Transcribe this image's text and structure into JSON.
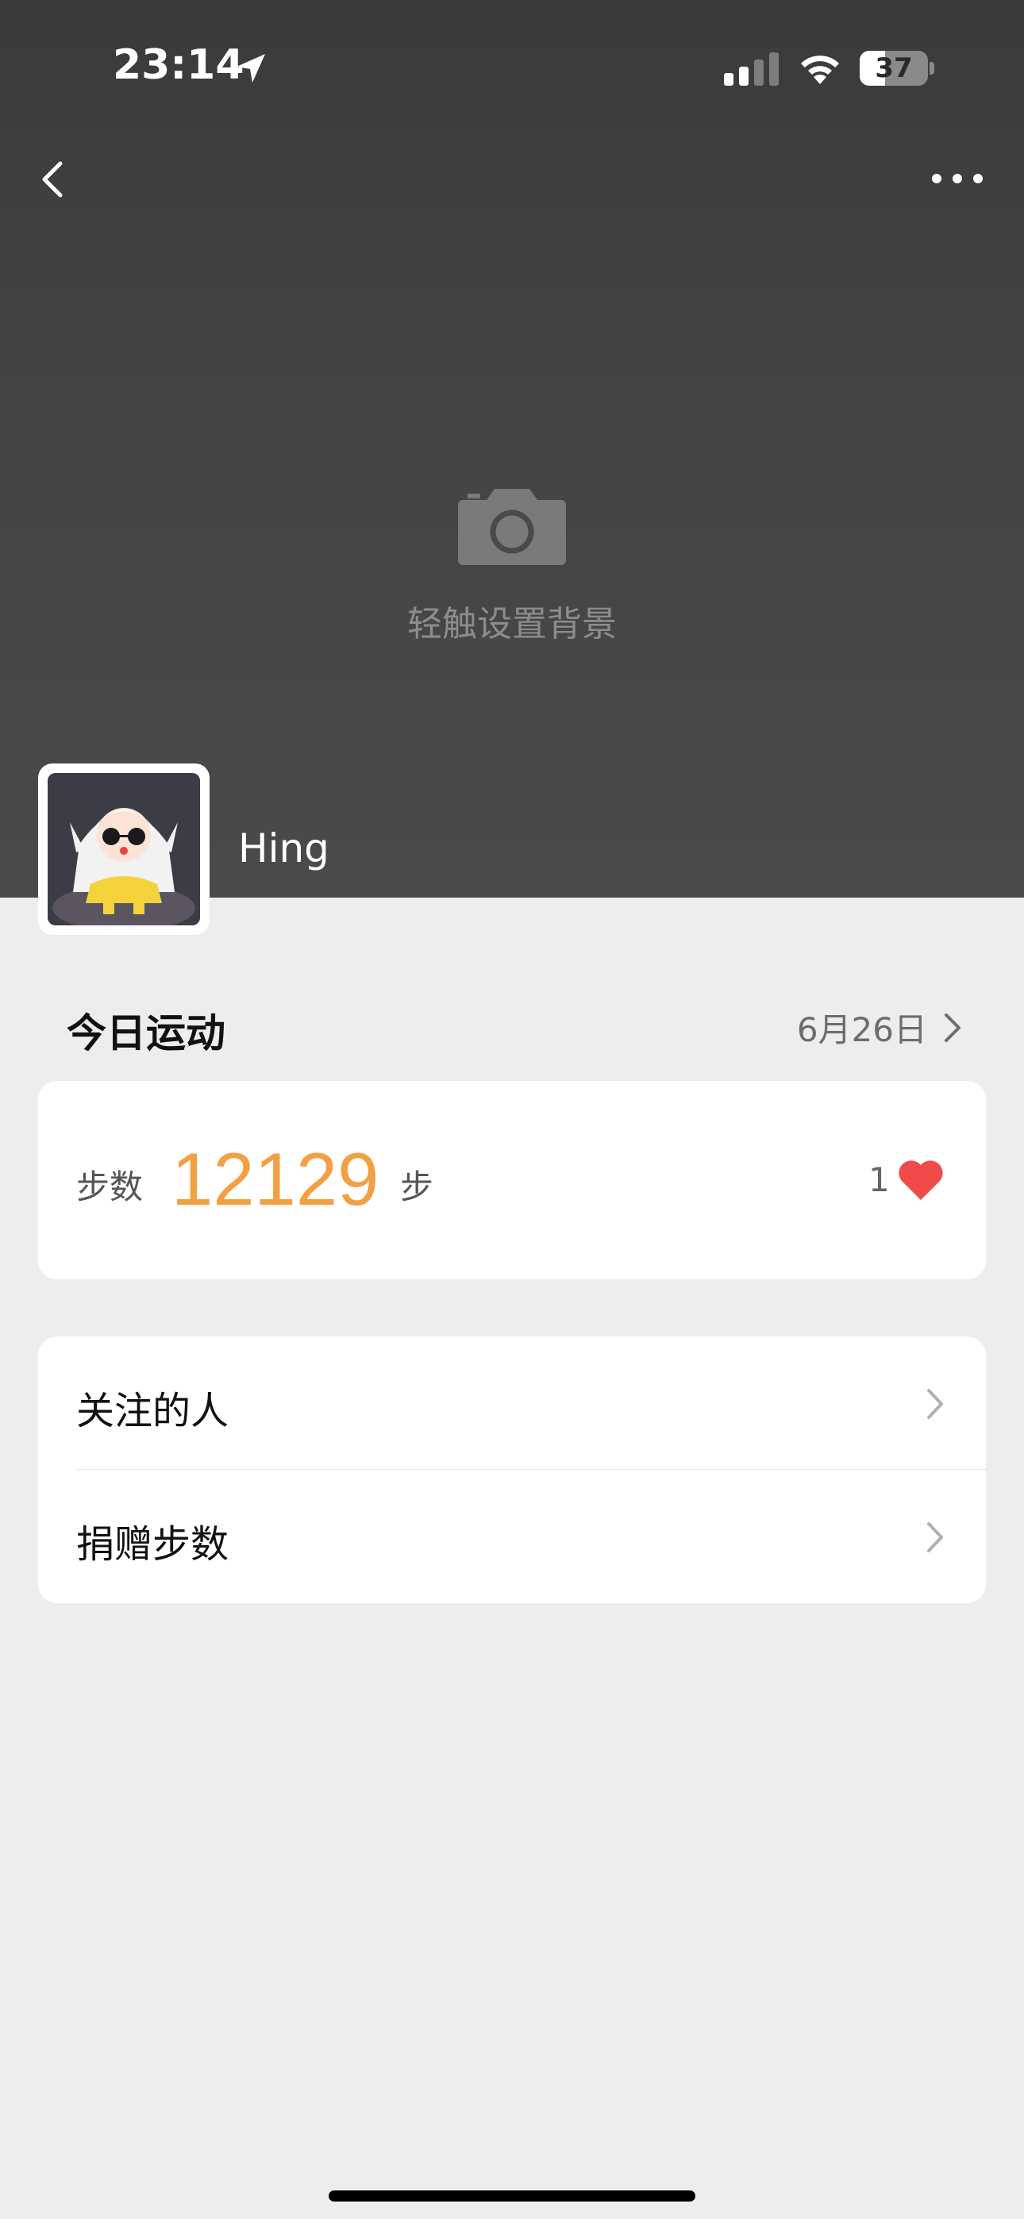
{
  "status_bar": {
    "time": "23:14",
    "battery": "37",
    "battery_level": 0.37
  },
  "header": {
    "set_background_label": "轻触设置背景"
  },
  "profile": {
    "name": "Hing"
  },
  "today": {
    "title": "今日运动",
    "date": "6月26日"
  },
  "steps": {
    "label": "步数",
    "value": "12129",
    "unit": "步",
    "likes": "1"
  },
  "list": {
    "items": [
      {
        "label": "关注的人"
      },
      {
        "label": "捐赠步数"
      }
    ]
  },
  "colors": {
    "accent_orange": "#f2a043",
    "heart_red": "#f04a4a",
    "cover_bg": "#424242"
  },
  "icons": [
    "location-icon",
    "signal-icon",
    "wifi-icon",
    "battery-icon",
    "back-icon",
    "more-icon",
    "camera-icon",
    "heart-icon",
    "chevron-right-icon"
  ]
}
